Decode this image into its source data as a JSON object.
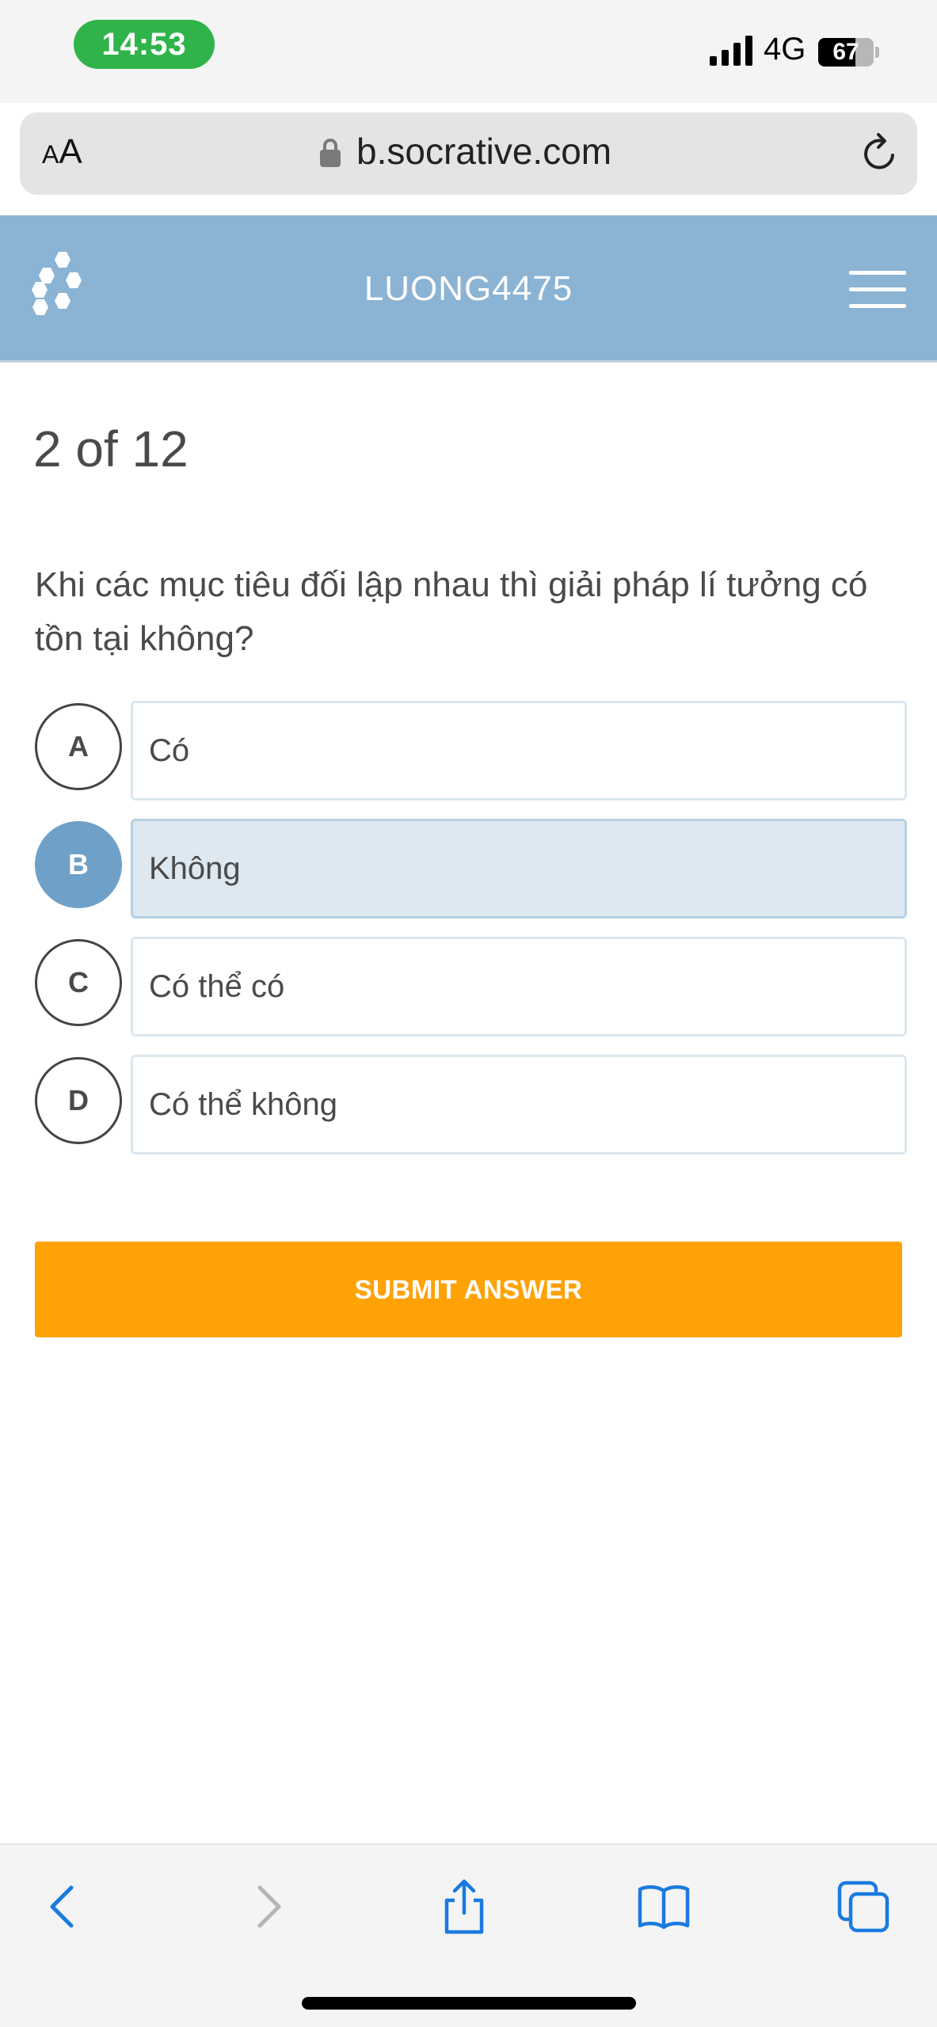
{
  "status_bar": {
    "time": "14:53",
    "network": "4G",
    "battery": "67",
    "battery_level": 0.67,
    "time_pill_color": "#30b34a",
    "icons": [
      "signal-icon",
      "battery-icon"
    ]
  },
  "browser": {
    "text_size_small": "A",
    "text_size_large": "A",
    "url": "b.socrative.com",
    "icons": [
      "lock-icon",
      "reload-icon"
    ]
  },
  "header": {
    "room": "LUONG4475",
    "background_color": "#8bb3d4",
    "icons": [
      "socrative-logo-icon",
      "menu-icon"
    ]
  },
  "quiz": {
    "progress": "2 of 12",
    "question": "Khi các mục tiêu đối lập nhau thì giải pháp lí tưởng có tồn tại không?",
    "choices": [
      {
        "letter": "A",
        "text": "Có",
        "selected": false
      },
      {
        "letter": "B",
        "text": "Không",
        "selected": true
      },
      {
        "letter": "C",
        "text": "Có thể có",
        "selected": false
      },
      {
        "letter": "D",
        "text": "Có thể không",
        "selected": false
      }
    ],
    "selected_color": "#6fa0c8",
    "submit_label": "SUBMIT ANSWER",
    "submit_color": "#ffa205"
  },
  "toolbar": {
    "icons": [
      "back-icon",
      "forward-icon",
      "share-icon",
      "bookmarks-icon",
      "tabs-icon"
    ],
    "accent_color": "#1a7ae0"
  }
}
